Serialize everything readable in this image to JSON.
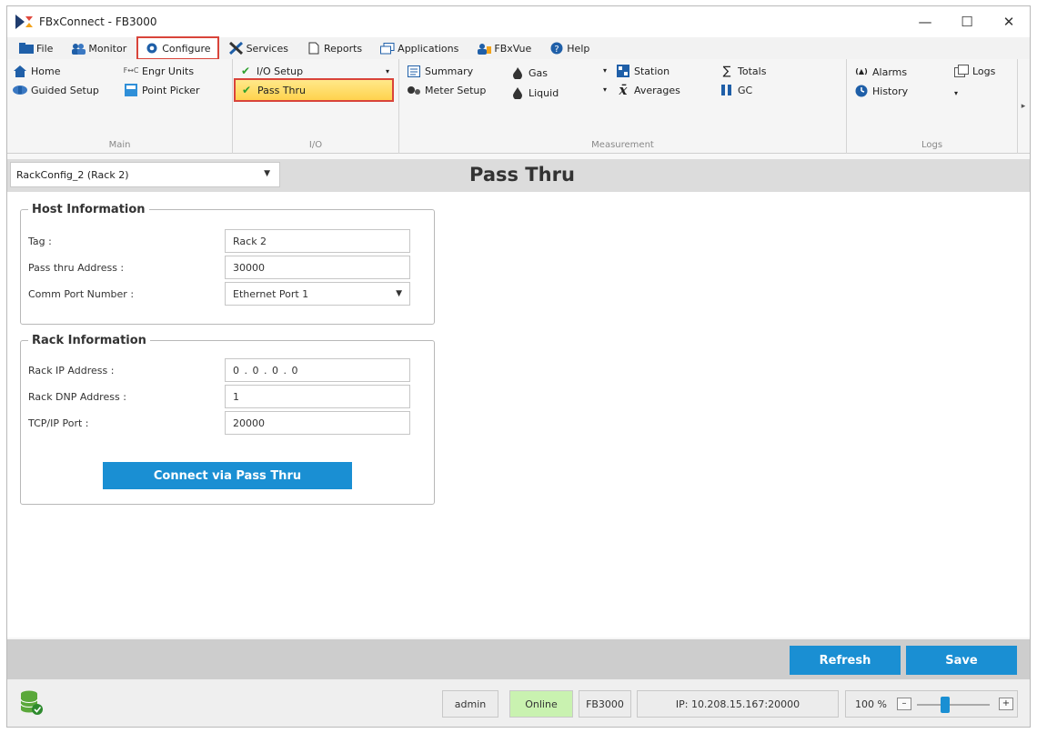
{
  "window": {
    "title": "FBxConnect - FB3000",
    "controls": {
      "minimize": "—",
      "maximize": "☐",
      "close": "✕"
    }
  },
  "menu": [
    {
      "label": "File",
      "icon": "folder-icon"
    },
    {
      "label": "Monitor",
      "icon": "monitor-icon"
    },
    {
      "label": "Configure",
      "icon": "gear-icon",
      "highlighted": true
    },
    {
      "label": "Services",
      "icon": "tools-icon"
    },
    {
      "label": "Reports",
      "icon": "document-icon"
    },
    {
      "label": "Applications",
      "icon": "windows-icon"
    },
    {
      "label": "FBxVue",
      "icon": "users-icon"
    },
    {
      "label": "Help",
      "icon": "help-icon"
    }
  ],
  "ribbon": {
    "main": {
      "group_label": "Main",
      "home": "Home",
      "engr_units": "Engr Units",
      "guided_setup": "Guided Setup",
      "point_picker": "Point Picker"
    },
    "io": {
      "group_label": "I/O",
      "io_setup": "I/O Setup",
      "pass_thru": "Pass Thru"
    },
    "measurement": {
      "group_label": "Measurement",
      "summary": "Summary",
      "meter_setup": "Meter Setup",
      "gas": "Gas",
      "liquid": "Liquid",
      "station": "Station",
      "averages": "Averages",
      "totals": "Totals",
      "gc": "GC"
    },
    "logs": {
      "group_label": "Logs",
      "alarms": "Alarms",
      "history": "History",
      "logs": "Logs"
    }
  },
  "rack_selector": {
    "value": "RackConfig_2 (Rack 2)"
  },
  "page_title": "Pass Thru",
  "host_info": {
    "legend": "Host Information",
    "tag_label": "Tag :",
    "tag_value": "Rack 2",
    "address_label": "Pass thru Address :",
    "address_value": "30000",
    "port_label": "Comm Port Number :",
    "port_value": "Ethernet Port 1"
  },
  "rack_info": {
    "legend": "Rack Information",
    "ip_label": "Rack IP Address :",
    "ip_value": "0 . 0 . 0 . 0",
    "dnp_label": "Rack DNP Address :",
    "dnp_value": "1",
    "tcp_label": "TCP/IP Port :",
    "tcp_value": "20000",
    "connect_button": "Connect via Pass Thru"
  },
  "actions": {
    "refresh": "Refresh",
    "save": "Save"
  },
  "status": {
    "user": "admin",
    "connection": "Online",
    "device": "FB3000",
    "ip": "IP: 10.208.15.167:20000",
    "zoom": "100 %"
  },
  "colors": {
    "accent": "#1a8fd3",
    "highlight_border": "#d9443a",
    "selected_fill": "#ffd24d",
    "online": "#c9f2b0"
  }
}
